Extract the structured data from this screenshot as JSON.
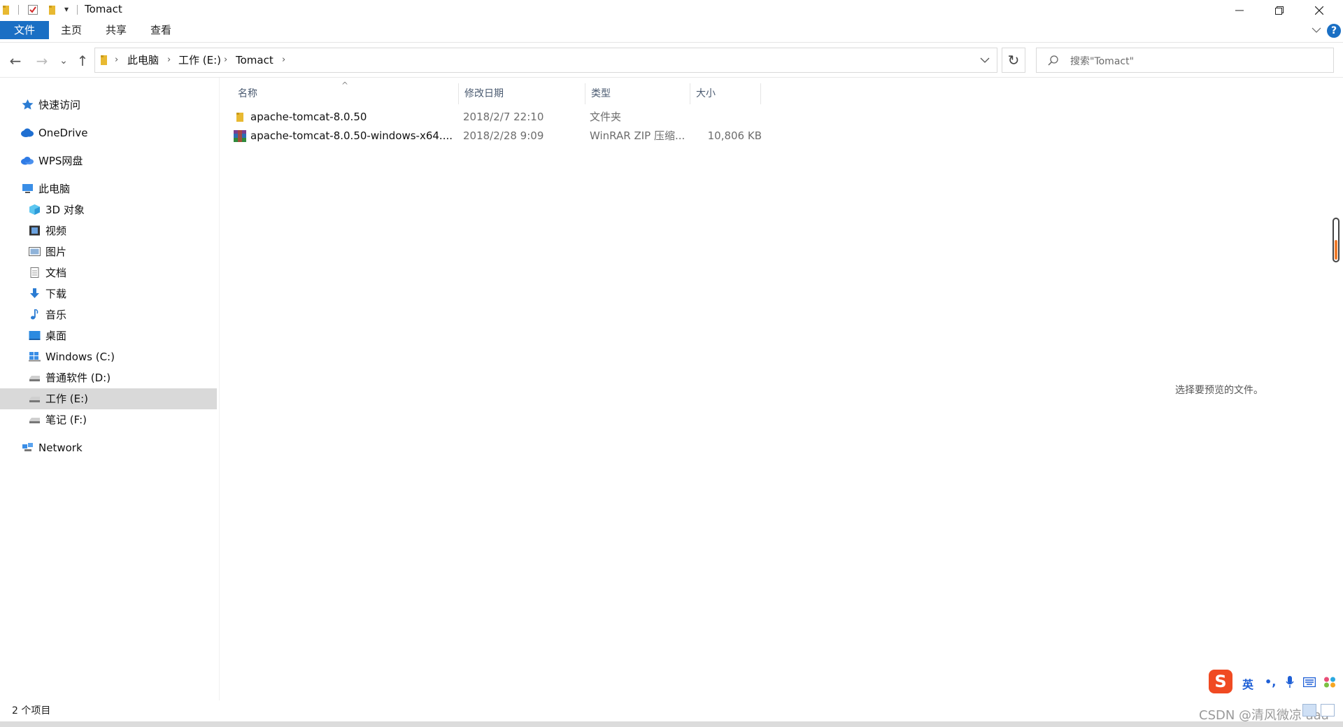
{
  "window": {
    "title": "Tomact",
    "controls": {
      "minimize": "—",
      "maximize": "❐",
      "close": "✕"
    },
    "quick_access_dropdown": "▾"
  },
  "ribbon": {
    "tabs": [
      {
        "label": "文件",
        "active": true
      },
      {
        "label": "主页",
        "active": false
      },
      {
        "label": "共享",
        "active": false
      },
      {
        "label": "查看",
        "active": false
      }
    ],
    "expand_icon": "chevron-down-icon",
    "help": "?"
  },
  "navigation": {
    "back": "←",
    "forward": "→",
    "recent": "⌄",
    "up": "↑",
    "breadcrumbs": [
      "此电脑",
      "工作 (E:)",
      "Tomact"
    ],
    "refresh": "↻",
    "search_placeholder": "搜索\"Tomact\""
  },
  "sidebar": {
    "items": [
      {
        "label": "快速访问",
        "icon": "star-icon"
      },
      {
        "label": "OneDrive",
        "icon": "cloud-icon"
      },
      {
        "label": "WPS网盘",
        "icon": "wps-cloud-icon"
      },
      {
        "label": "此电脑",
        "icon": "computer-icon"
      },
      {
        "label": "3D 对象",
        "icon": "cube-icon"
      },
      {
        "label": "视频",
        "icon": "video-icon"
      },
      {
        "label": "图片",
        "icon": "picture-icon"
      },
      {
        "label": "文档",
        "icon": "document-icon"
      },
      {
        "label": "下载",
        "icon": "download-icon"
      },
      {
        "label": "音乐",
        "icon": "music-icon"
      },
      {
        "label": "桌面",
        "icon": "desktop-icon"
      },
      {
        "label": "Windows (C:)",
        "icon": "windows-drive-icon"
      },
      {
        "label": "普通软件 (D:)",
        "icon": "drive-icon"
      },
      {
        "label": "工作 (E:)",
        "icon": "drive-icon",
        "selected": true
      },
      {
        "label": "笔记 (F:)",
        "icon": "drive-icon"
      },
      {
        "label": "Network",
        "icon": "network-icon"
      }
    ]
  },
  "file_list": {
    "columns": [
      "名称",
      "修改日期",
      "类型",
      "大小"
    ],
    "sort_indicator": "^",
    "rows": [
      {
        "name": "apache-tomcat-8.0.50",
        "modified": "2018/2/7 22:10",
        "type": "文件夹",
        "size": "",
        "icon": "folder-icon"
      },
      {
        "name": "apache-tomcat-8.0.50-windows-x64....",
        "modified": "2018/2/28 9:09",
        "type": "WinRAR ZIP 压缩...",
        "size": "10,806 KB",
        "icon": "winrar-archive-icon"
      }
    ]
  },
  "preview_pane": {
    "message": "选择要预览的文件。"
  },
  "status_bar": {
    "item_count": "2 个项目"
  },
  "ime_toolbar": {
    "logo": "S",
    "language": "英",
    "punct": "•,",
    "mic": "mic-icon",
    "keyboard": "keyboard-icon",
    "skin": "skin-icon"
  },
  "watermark": "CSDN @清风微凉 aaa",
  "colors": {
    "accent": "#1a6fc4",
    "selection": "#d9d9d9",
    "folder": "#e8b931"
  }
}
